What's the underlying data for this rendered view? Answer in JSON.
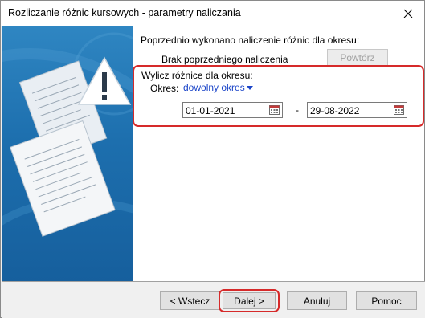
{
  "window": {
    "title": "Rozliczanie różnic kursowych - parametry naliczania"
  },
  "previous": {
    "heading": "Poprzednio wykonano naliczenie różnic dla okresu:",
    "status": "Brak poprzedniego naliczenia",
    "repeat_label": "Powtórz"
  },
  "calc": {
    "heading": "Wylicz różnice dla okresu:",
    "period_label": "Okres:",
    "period_value": "dowolny okres",
    "date_from": "01-01-2021",
    "separator": "-",
    "date_to": "29-08-2022"
  },
  "buttons": {
    "back": "< Wstecz",
    "next": "Dalej >",
    "cancel": "Anuluj",
    "help": "Pomoc"
  },
  "icons": {
    "close": "close-icon",
    "warning": "warning-icon",
    "calendar": "calendar-icon",
    "documents": "documents-illustration"
  },
  "colors": {
    "highlight": "#d62a2a",
    "panel_blue": "#1d6fae",
    "link_blue": "#1a44c8"
  }
}
